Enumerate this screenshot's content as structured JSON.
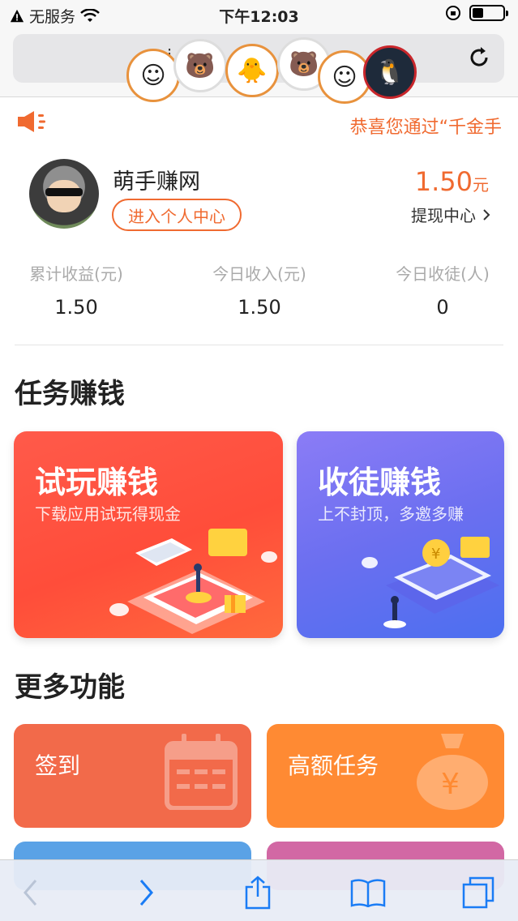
{
  "status_bar": {
    "carrier": "无服务",
    "time": "下午12:03",
    "battery_level": 0.35
  },
  "browser": {
    "url_fragment": "i          m",
    "reload_icon": "reload-icon"
  },
  "notice": {
    "text": "恭喜您通过“千金手",
    "icon": "speaker-icon"
  },
  "user": {
    "name": "萌手赚网",
    "enter_button": "进入个人中心",
    "balance_value": "1.50",
    "balance_unit": "元",
    "withdraw_label": "提现中心"
  },
  "stats": [
    {
      "label": "累计收益(元)",
      "value": "1.50"
    },
    {
      "label": "今日收入(元)",
      "value": "1.50"
    },
    {
      "label": "今日收徒(人)",
      "value": "0"
    }
  ],
  "sections": {
    "tasks_title": "任务赚钱",
    "more_title": "更多功能"
  },
  "task_cards": [
    {
      "title": "试玩赚钱",
      "subtitle": "下载应用试玩得现金"
    },
    {
      "title": "收徒赚钱",
      "subtitle": "上不封顶，多邀多赚"
    }
  ],
  "features": [
    {
      "title": "签到",
      "icon": "calendar-icon",
      "color": "#f26a4a"
    },
    {
      "title": "高额任务",
      "icon": "money-bag-icon",
      "color": "#ff8a33"
    }
  ],
  "colors": {
    "accent": "#f06a30",
    "trial_card": "#ff4d3a",
    "recruit_card": "#6b6ff0"
  }
}
